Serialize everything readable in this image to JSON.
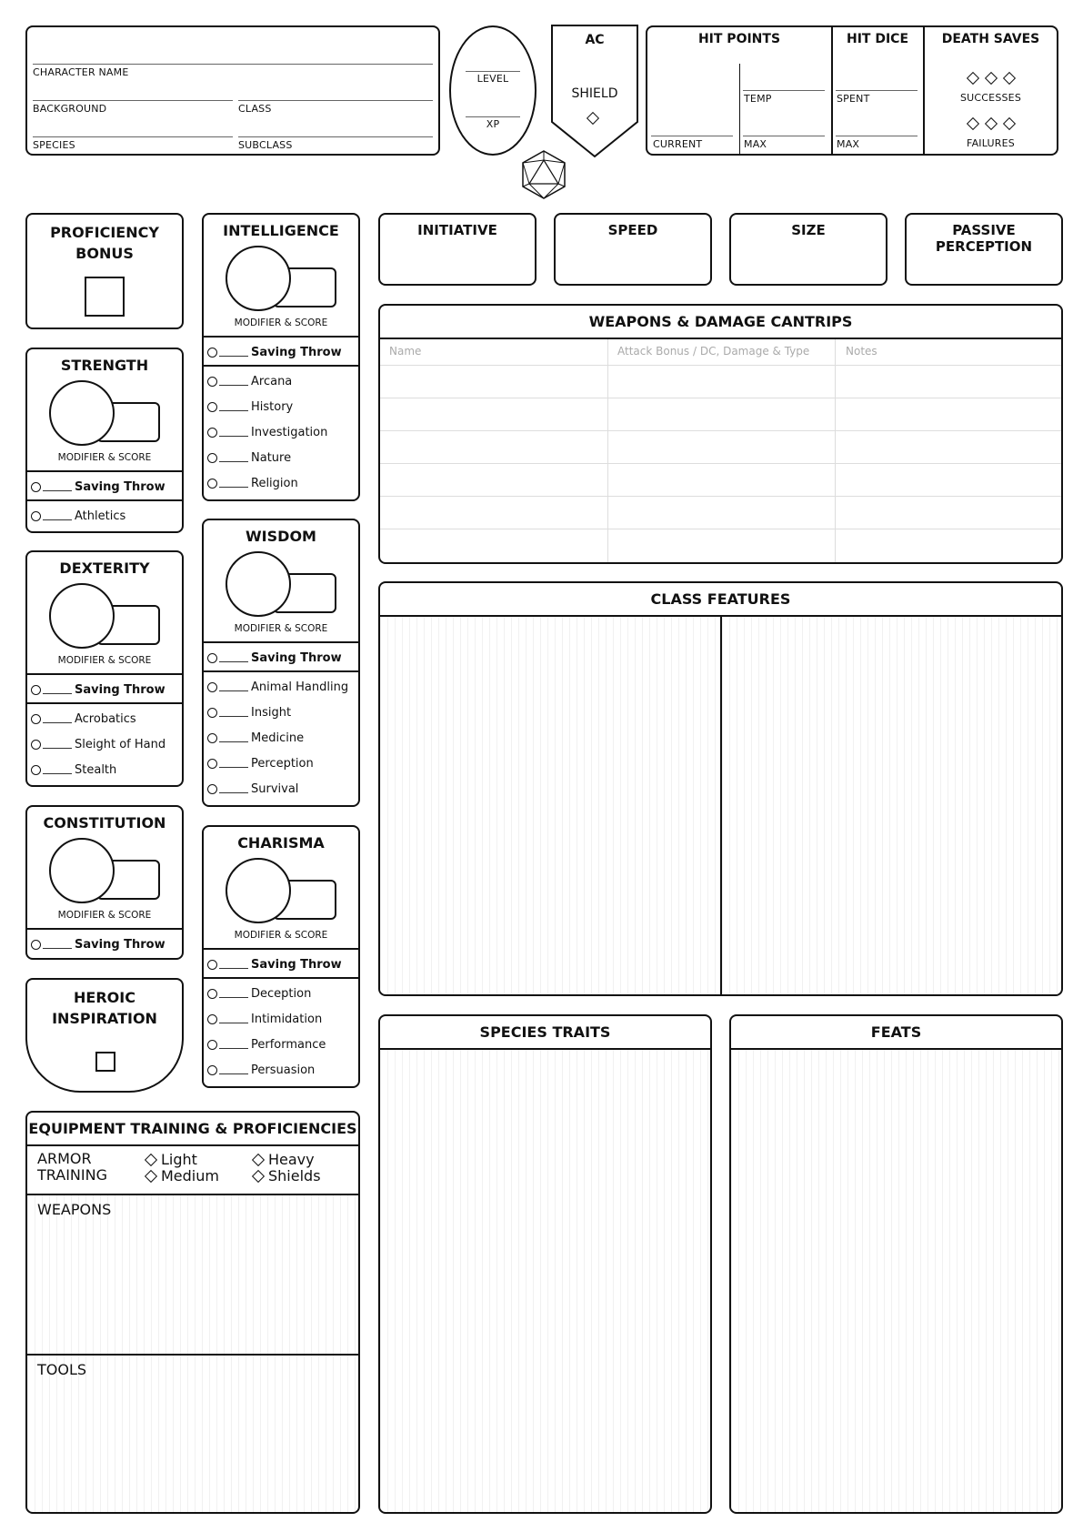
{
  "header": {
    "character_name_label": "CHARACTER NAME",
    "background_label": "BACKGROUND",
    "class_label": "CLASS",
    "species_label": "SPECIES",
    "subclass_label": "SUBCLASS",
    "level_label": "LEVEL",
    "xp_label": "XP",
    "ac_label": "AC",
    "shield_label": "SHIELD",
    "hit_points": {
      "title": "HIT POINTS",
      "current": "CURRENT",
      "temp": "TEMP",
      "max": "MAX"
    },
    "hit_dice": {
      "title": "HIT DICE",
      "spent": "SPENT",
      "max": "MAX"
    },
    "death_saves": {
      "title": "DEATH SAVES",
      "successes": "SUCCESSES",
      "failures": "FAILURES"
    }
  },
  "proficiency_bonus": "PROFICIENCY BONUS",
  "heroic_inspiration": "HEROIC INSPIRATION",
  "modifier_score_label": "MODIFIER & SCORE",
  "saving_throw_label": "Saving Throw",
  "abilities": {
    "strength": {
      "name": "STRENGTH",
      "skills": [
        "Athletics"
      ]
    },
    "dexterity": {
      "name": "DEXTERITY",
      "skills": [
        "Acrobatics",
        "Sleight of Hand",
        "Stealth"
      ]
    },
    "constitution": {
      "name": "CONSTITUTION",
      "skills": []
    },
    "intelligence": {
      "name": "INTELLIGENCE",
      "skills": [
        "Arcana",
        "History",
        "Investigation",
        "Nature",
        "Religion"
      ]
    },
    "wisdom": {
      "name": "WISDOM",
      "skills": [
        "Animal Handling",
        "Insight",
        "Medicine",
        "Perception",
        "Survival"
      ]
    },
    "charisma": {
      "name": "CHARISMA",
      "skills": [
        "Deception",
        "Intimidation",
        "Performance",
        "Persuasion"
      ]
    }
  },
  "stats": {
    "initiative": "INITIATIVE",
    "speed": "SPEED",
    "size": "SIZE",
    "passive_perception": "PASSIVE PERCEPTION"
  },
  "weapons": {
    "title": "WEAPONS & DAMAGE CANTRIPS",
    "columns": [
      "Name",
      "Attack Bonus / DC, Damage & Type",
      "Notes"
    ]
  },
  "class_features": "CLASS FEATURES",
  "species_traits": "SPECIES TRAITS",
  "feats": "FEATS",
  "equipment": {
    "title": "EQUIPMENT TRAINING & PROFICIENCIES",
    "armor_label_1": "ARMOR",
    "armor_label_2": "TRAINING",
    "light": "Light",
    "medium": "Medium",
    "heavy": "Heavy",
    "shields": "Shields",
    "weapons": "WEAPONS",
    "tools": "TOOLS"
  }
}
